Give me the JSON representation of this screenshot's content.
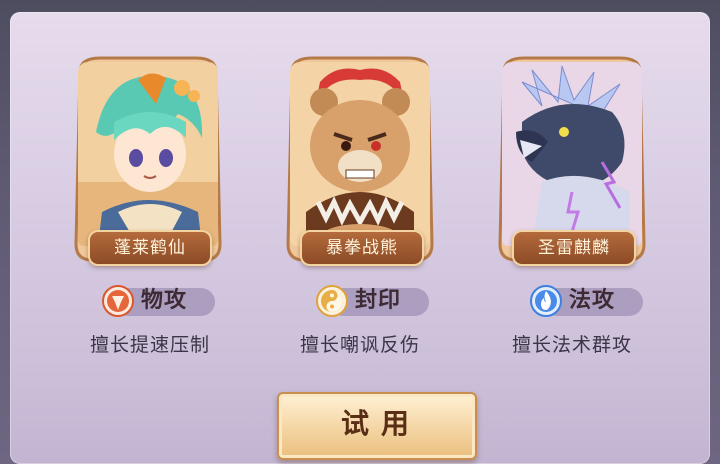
{
  "characters": [
    {
      "name": "蓬莱鹤仙",
      "role": "物攻",
      "description": "擅长提速压制",
      "role_color": "#d9572f"
    },
    {
      "name": "暴拳战熊",
      "role": "封印",
      "description": "擅长嘲讽反伤",
      "role_color": "#e0a23a"
    },
    {
      "name": "圣雷麒麟",
      "role": "法攻",
      "description": "擅长法术群攻",
      "role_color": "#3f7fe0"
    }
  ],
  "action": {
    "try_label": "试用"
  },
  "colors": {
    "frame": "#e8b98a",
    "nameplate": "#9a5530",
    "button": "#f4d5a3"
  }
}
